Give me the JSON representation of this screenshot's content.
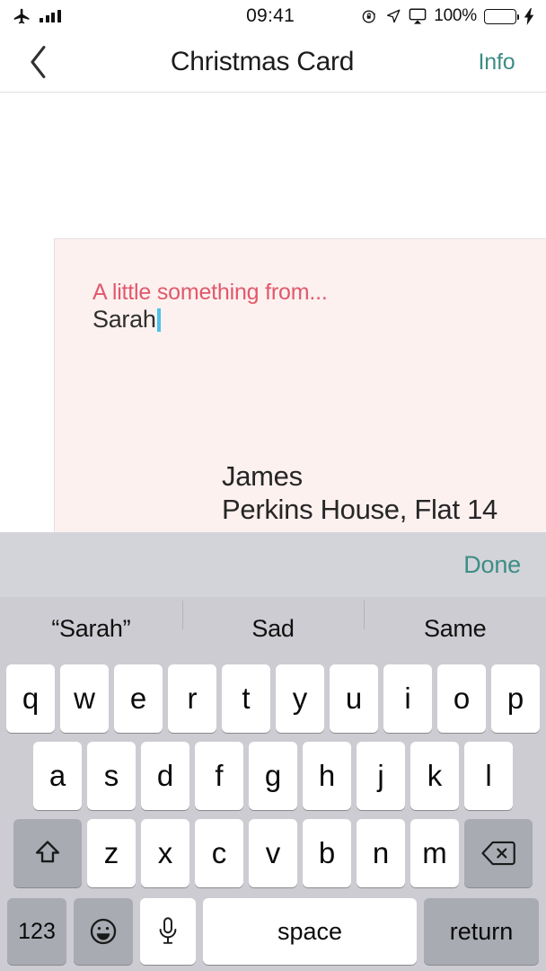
{
  "status_bar": {
    "airplane_mode": true,
    "signal_bars": 4,
    "time": "09:41",
    "rotation_lock": true,
    "location": true,
    "airplay": true,
    "battery_percent": "100%",
    "battery_color": "#4cd964",
    "charging": true
  },
  "nav_bar": {
    "back_label": "",
    "title": "Christmas Card",
    "info_label": "Info",
    "accent_color": "#3d8d86"
  },
  "card": {
    "greeting": "A little something from...",
    "greeting_color": "#e0596b",
    "signature": "Sarah",
    "background_color": "#fdf1f0",
    "address": [
      "James",
      "Perkins House, Flat 14"
    ],
    "cursor_color": "#4fc0e8"
  },
  "keyboard_toolbar": {
    "done_label": "Done",
    "done_color": "#3d8d86"
  },
  "predictive": {
    "suggestions": [
      "“Sarah”",
      "Sad",
      "Same"
    ]
  },
  "keyboard": {
    "row1": [
      "q",
      "w",
      "e",
      "r",
      "t",
      "y",
      "u",
      "i",
      "o",
      "p"
    ],
    "row2": [
      "a",
      "s",
      "d",
      "f",
      "g",
      "h",
      "j",
      "k",
      "l"
    ],
    "row3": [
      "z",
      "x",
      "c",
      "v",
      "b",
      "n",
      "m"
    ],
    "shift_icon": "shift-arrow-icon",
    "delete_icon": "backspace-icon",
    "numbers_label": "123",
    "emoji_icon": "smiley-icon",
    "dictation_icon": "microphone-icon",
    "space_label": "space",
    "return_label": "return",
    "background_color": "#ccccd2",
    "key_color": "#ffffff",
    "modifier_key_color": "#a9abb3"
  }
}
